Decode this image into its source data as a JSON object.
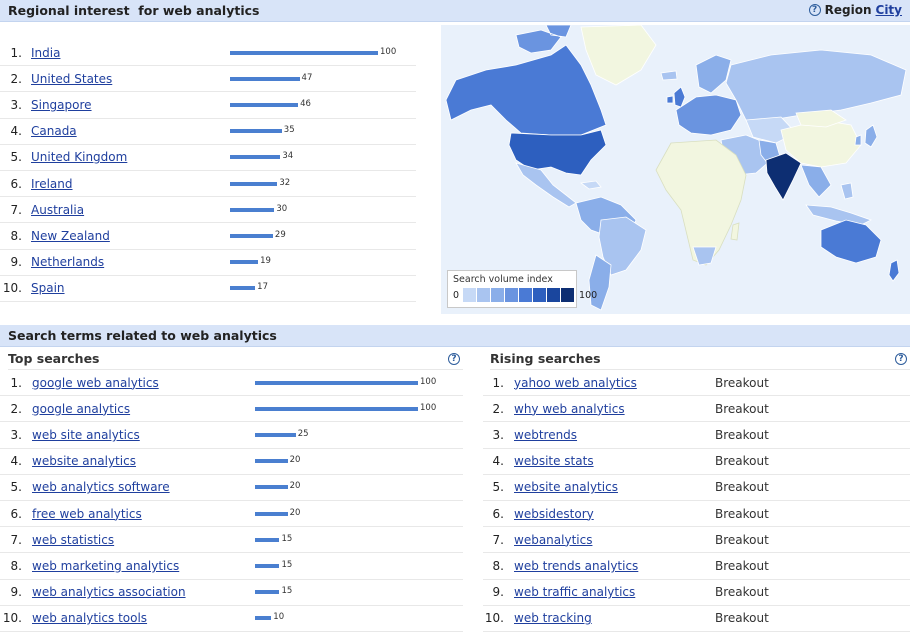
{
  "regional": {
    "title": "Regional interest  for web analytics",
    "region_label": "Region",
    "region_link": "City",
    "help_glyph": "?",
    "rows": [
      {
        "rank": "1.",
        "name": "India",
        "value": "100",
        "score": 100
      },
      {
        "rank": "2.",
        "name": "United States",
        "value": "47",
        "score": 47
      },
      {
        "rank": "3.",
        "name": "Singapore",
        "value": "46",
        "score": 46
      },
      {
        "rank": "4.",
        "name": "Canada",
        "value": "35",
        "score": 35
      },
      {
        "rank": "5.",
        "name": "United Kingdom",
        "value": "34",
        "score": 34
      },
      {
        "rank": "6.",
        "name": "Ireland",
        "value": "32",
        "score": 32
      },
      {
        "rank": "7.",
        "name": "Australia",
        "value": "30",
        "score": 30
      },
      {
        "rank": "8.",
        "name": "New Zealand",
        "value": "29",
        "score": 29
      },
      {
        "rank": "9.",
        "name": "Netherlands",
        "value": "19",
        "score": 19
      },
      {
        "rank": "10.",
        "name": "Spain",
        "value": "17",
        "score": 17
      }
    ],
    "legend": {
      "title": "Search volume index",
      "min": "0",
      "max": "100",
      "colors": [
        "#c6d9f6",
        "#a9c4f0",
        "#8aaee9",
        "#6a94e0",
        "#4a7ad5",
        "#2d5fbf",
        "#1a469e",
        "#0d2e72"
      ]
    }
  },
  "related": {
    "title": "Search terms related to web analytics",
    "top": {
      "heading": "Top searches",
      "help_glyph": "?",
      "rows": [
        {
          "rank": "1.",
          "term": "google web analytics",
          "value": "100",
          "score": 100
        },
        {
          "rank": "2.",
          "term": "google analytics",
          "value": "100",
          "score": 100
        },
        {
          "rank": "3.",
          "term": "web site analytics",
          "value": "25",
          "score": 25
        },
        {
          "rank": "4.",
          "term": "website analytics",
          "value": "20",
          "score": 20
        },
        {
          "rank": "5.",
          "term": "web analytics software",
          "value": "20",
          "score": 20
        },
        {
          "rank": "6.",
          "term": "free web analytics",
          "value": "20",
          "score": 20
        },
        {
          "rank": "7.",
          "term": "web statistics",
          "value": "15",
          "score": 15
        },
        {
          "rank": "8.",
          "term": "web marketing analytics",
          "value": "15",
          "score": 15
        },
        {
          "rank": "9.",
          "term": "web analytics association",
          "value": "15",
          "score": 15
        },
        {
          "rank": "10.",
          "term": "web analytics tools",
          "value": "10",
          "score": 10
        }
      ]
    },
    "rising": {
      "heading": "Rising searches",
      "help_glyph": "?",
      "rows": [
        {
          "rank": "1.",
          "term": "yahoo web analytics",
          "status": "Breakout"
        },
        {
          "rank": "2.",
          "term": "why web analytics",
          "status": "Breakout"
        },
        {
          "rank": "3.",
          "term": "webtrends",
          "status": "Breakout"
        },
        {
          "rank": "4.",
          "term": "website stats",
          "status": "Breakout"
        },
        {
          "rank": "5.",
          "term": "website analytics",
          "status": "Breakout"
        },
        {
          "rank": "6.",
          "term": "websidestory",
          "status": "Breakout"
        },
        {
          "rank": "7.",
          "term": "webanalytics",
          "status": "Breakout"
        },
        {
          "rank": "8.",
          "term": "web trends analytics",
          "status": "Breakout"
        },
        {
          "rank": "9.",
          "term": "web traffic analytics",
          "status": "Breakout"
        },
        {
          "rank": "10.",
          "term": "web tracking",
          "status": "Breakout"
        }
      ]
    }
  },
  "colors": {
    "bar": "#4a7fd0",
    "header_bg": "#d8e4f8",
    "link": "#1f3f9e",
    "map_ocean": "#e9f1fb",
    "map_top": "#0d2e72",
    "map_low": "#f2f6e0"
  }
}
